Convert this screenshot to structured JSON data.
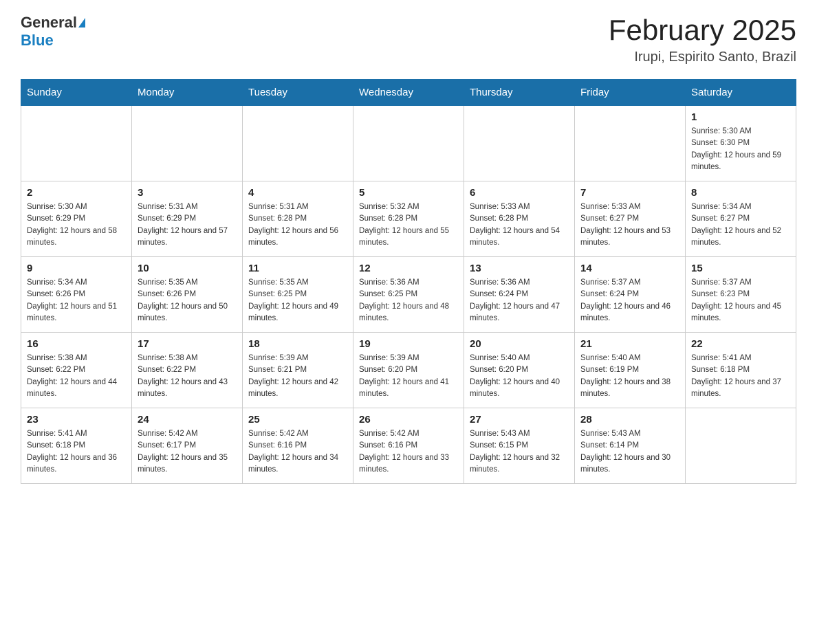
{
  "header": {
    "logo_general": "General",
    "logo_blue": "Blue",
    "month_title": "February 2025",
    "location": "Irupi, Espirito Santo, Brazil"
  },
  "days_of_week": [
    "Sunday",
    "Monday",
    "Tuesday",
    "Wednesday",
    "Thursday",
    "Friday",
    "Saturday"
  ],
  "weeks": [
    [
      {
        "day": "",
        "info": ""
      },
      {
        "day": "",
        "info": ""
      },
      {
        "day": "",
        "info": ""
      },
      {
        "day": "",
        "info": ""
      },
      {
        "day": "",
        "info": ""
      },
      {
        "day": "",
        "info": ""
      },
      {
        "day": "1",
        "info": "Sunrise: 5:30 AM\nSunset: 6:30 PM\nDaylight: 12 hours and 59 minutes."
      }
    ],
    [
      {
        "day": "2",
        "info": "Sunrise: 5:30 AM\nSunset: 6:29 PM\nDaylight: 12 hours and 58 minutes."
      },
      {
        "day": "3",
        "info": "Sunrise: 5:31 AM\nSunset: 6:29 PM\nDaylight: 12 hours and 57 minutes."
      },
      {
        "day": "4",
        "info": "Sunrise: 5:31 AM\nSunset: 6:28 PM\nDaylight: 12 hours and 56 minutes."
      },
      {
        "day": "5",
        "info": "Sunrise: 5:32 AM\nSunset: 6:28 PM\nDaylight: 12 hours and 55 minutes."
      },
      {
        "day": "6",
        "info": "Sunrise: 5:33 AM\nSunset: 6:28 PM\nDaylight: 12 hours and 54 minutes."
      },
      {
        "day": "7",
        "info": "Sunrise: 5:33 AM\nSunset: 6:27 PM\nDaylight: 12 hours and 53 minutes."
      },
      {
        "day": "8",
        "info": "Sunrise: 5:34 AM\nSunset: 6:27 PM\nDaylight: 12 hours and 52 minutes."
      }
    ],
    [
      {
        "day": "9",
        "info": "Sunrise: 5:34 AM\nSunset: 6:26 PM\nDaylight: 12 hours and 51 minutes."
      },
      {
        "day": "10",
        "info": "Sunrise: 5:35 AM\nSunset: 6:26 PM\nDaylight: 12 hours and 50 minutes."
      },
      {
        "day": "11",
        "info": "Sunrise: 5:35 AM\nSunset: 6:25 PM\nDaylight: 12 hours and 49 minutes."
      },
      {
        "day": "12",
        "info": "Sunrise: 5:36 AM\nSunset: 6:25 PM\nDaylight: 12 hours and 48 minutes."
      },
      {
        "day": "13",
        "info": "Sunrise: 5:36 AM\nSunset: 6:24 PM\nDaylight: 12 hours and 47 minutes."
      },
      {
        "day": "14",
        "info": "Sunrise: 5:37 AM\nSunset: 6:24 PM\nDaylight: 12 hours and 46 minutes."
      },
      {
        "day": "15",
        "info": "Sunrise: 5:37 AM\nSunset: 6:23 PM\nDaylight: 12 hours and 45 minutes."
      }
    ],
    [
      {
        "day": "16",
        "info": "Sunrise: 5:38 AM\nSunset: 6:22 PM\nDaylight: 12 hours and 44 minutes."
      },
      {
        "day": "17",
        "info": "Sunrise: 5:38 AM\nSunset: 6:22 PM\nDaylight: 12 hours and 43 minutes."
      },
      {
        "day": "18",
        "info": "Sunrise: 5:39 AM\nSunset: 6:21 PM\nDaylight: 12 hours and 42 minutes."
      },
      {
        "day": "19",
        "info": "Sunrise: 5:39 AM\nSunset: 6:20 PM\nDaylight: 12 hours and 41 minutes."
      },
      {
        "day": "20",
        "info": "Sunrise: 5:40 AM\nSunset: 6:20 PM\nDaylight: 12 hours and 40 minutes."
      },
      {
        "day": "21",
        "info": "Sunrise: 5:40 AM\nSunset: 6:19 PM\nDaylight: 12 hours and 38 minutes."
      },
      {
        "day": "22",
        "info": "Sunrise: 5:41 AM\nSunset: 6:18 PM\nDaylight: 12 hours and 37 minutes."
      }
    ],
    [
      {
        "day": "23",
        "info": "Sunrise: 5:41 AM\nSunset: 6:18 PM\nDaylight: 12 hours and 36 minutes."
      },
      {
        "day": "24",
        "info": "Sunrise: 5:42 AM\nSunset: 6:17 PM\nDaylight: 12 hours and 35 minutes."
      },
      {
        "day": "25",
        "info": "Sunrise: 5:42 AM\nSunset: 6:16 PM\nDaylight: 12 hours and 34 minutes."
      },
      {
        "day": "26",
        "info": "Sunrise: 5:42 AM\nSunset: 6:16 PM\nDaylight: 12 hours and 33 minutes."
      },
      {
        "day": "27",
        "info": "Sunrise: 5:43 AM\nSunset: 6:15 PM\nDaylight: 12 hours and 32 minutes."
      },
      {
        "day": "28",
        "info": "Sunrise: 5:43 AM\nSunset: 6:14 PM\nDaylight: 12 hours and 30 minutes."
      },
      {
        "day": "",
        "info": ""
      }
    ]
  ]
}
